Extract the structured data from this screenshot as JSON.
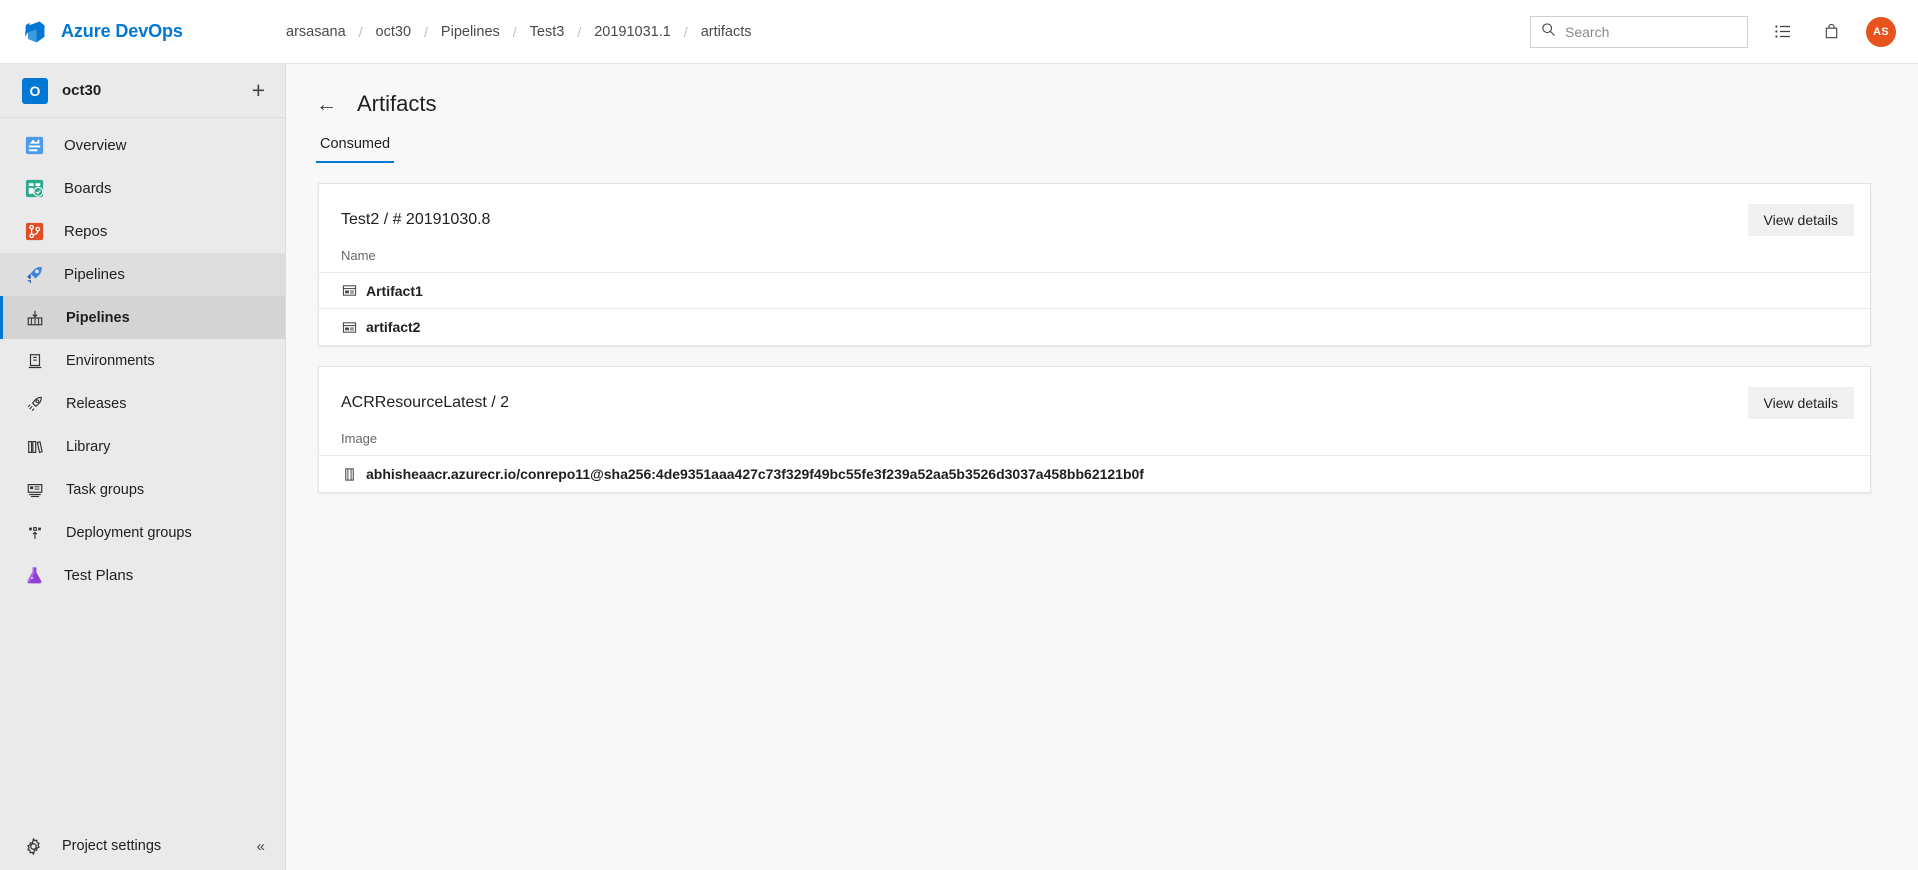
{
  "topbar": {
    "brand": "Azure DevOps",
    "brand_color": "#0078d4",
    "breadcrumb": [
      "arsasana",
      "oct30",
      "Pipelines",
      "Test3",
      "20191031.1",
      "artifacts"
    ],
    "separator": "/",
    "search": {
      "placeholder": "Search",
      "value": ""
    },
    "avatar_initials": "AS",
    "avatar_color": "#e8521f"
  },
  "sidebar": {
    "project": {
      "name": "oct30",
      "initial": "O"
    },
    "add_label": "+",
    "items": [
      {
        "label": "Overview",
        "icon": "overview-icon"
      },
      {
        "label": "Boards",
        "icon": "boards-icon"
      },
      {
        "label": "Repos",
        "icon": "repos-icon"
      },
      {
        "label": "Pipelines",
        "icon": "pipelines-icon"
      }
    ],
    "subitems": [
      {
        "label": "Pipelines",
        "icon": "pipelines-sub-icon"
      },
      {
        "label": "Environments",
        "icon": "environments-icon"
      },
      {
        "label": "Releases",
        "icon": "releases-icon"
      },
      {
        "label": "Library",
        "icon": "library-icon"
      },
      {
        "label": "Task groups",
        "icon": "task-groups-icon"
      },
      {
        "label": "Deployment groups",
        "icon": "deployment-groups-icon"
      }
    ],
    "test_plans": {
      "label": "Test Plans",
      "icon": "test-plans-icon"
    },
    "settings": {
      "label": "Project settings",
      "icon": "gear-icon"
    },
    "collapse": "«"
  },
  "main": {
    "title": "Artifacts",
    "back": "←",
    "tabs": [
      {
        "label": "Consumed",
        "active": true
      }
    ],
    "cards": [
      {
        "title": "Test2 / # 20191030.8",
        "button": "View details",
        "column_header": "Name",
        "rows": [
          {
            "name": "Artifact1",
            "icon": "artifact-icon"
          },
          {
            "name": "artifact2",
            "icon": "artifact-icon"
          }
        ]
      },
      {
        "title": "ACRResourceLatest / 2",
        "button": "View details",
        "column_header": "Image",
        "rows": [
          {
            "name": "abhisheaacr.azurecr.io/conrepo11@sha256:4de9351aaa427c73f329f49bc55fe3f239a52aa5b3526d3037a458bb62121b0f",
            "icon": "container-image-icon"
          }
        ]
      }
    ]
  }
}
